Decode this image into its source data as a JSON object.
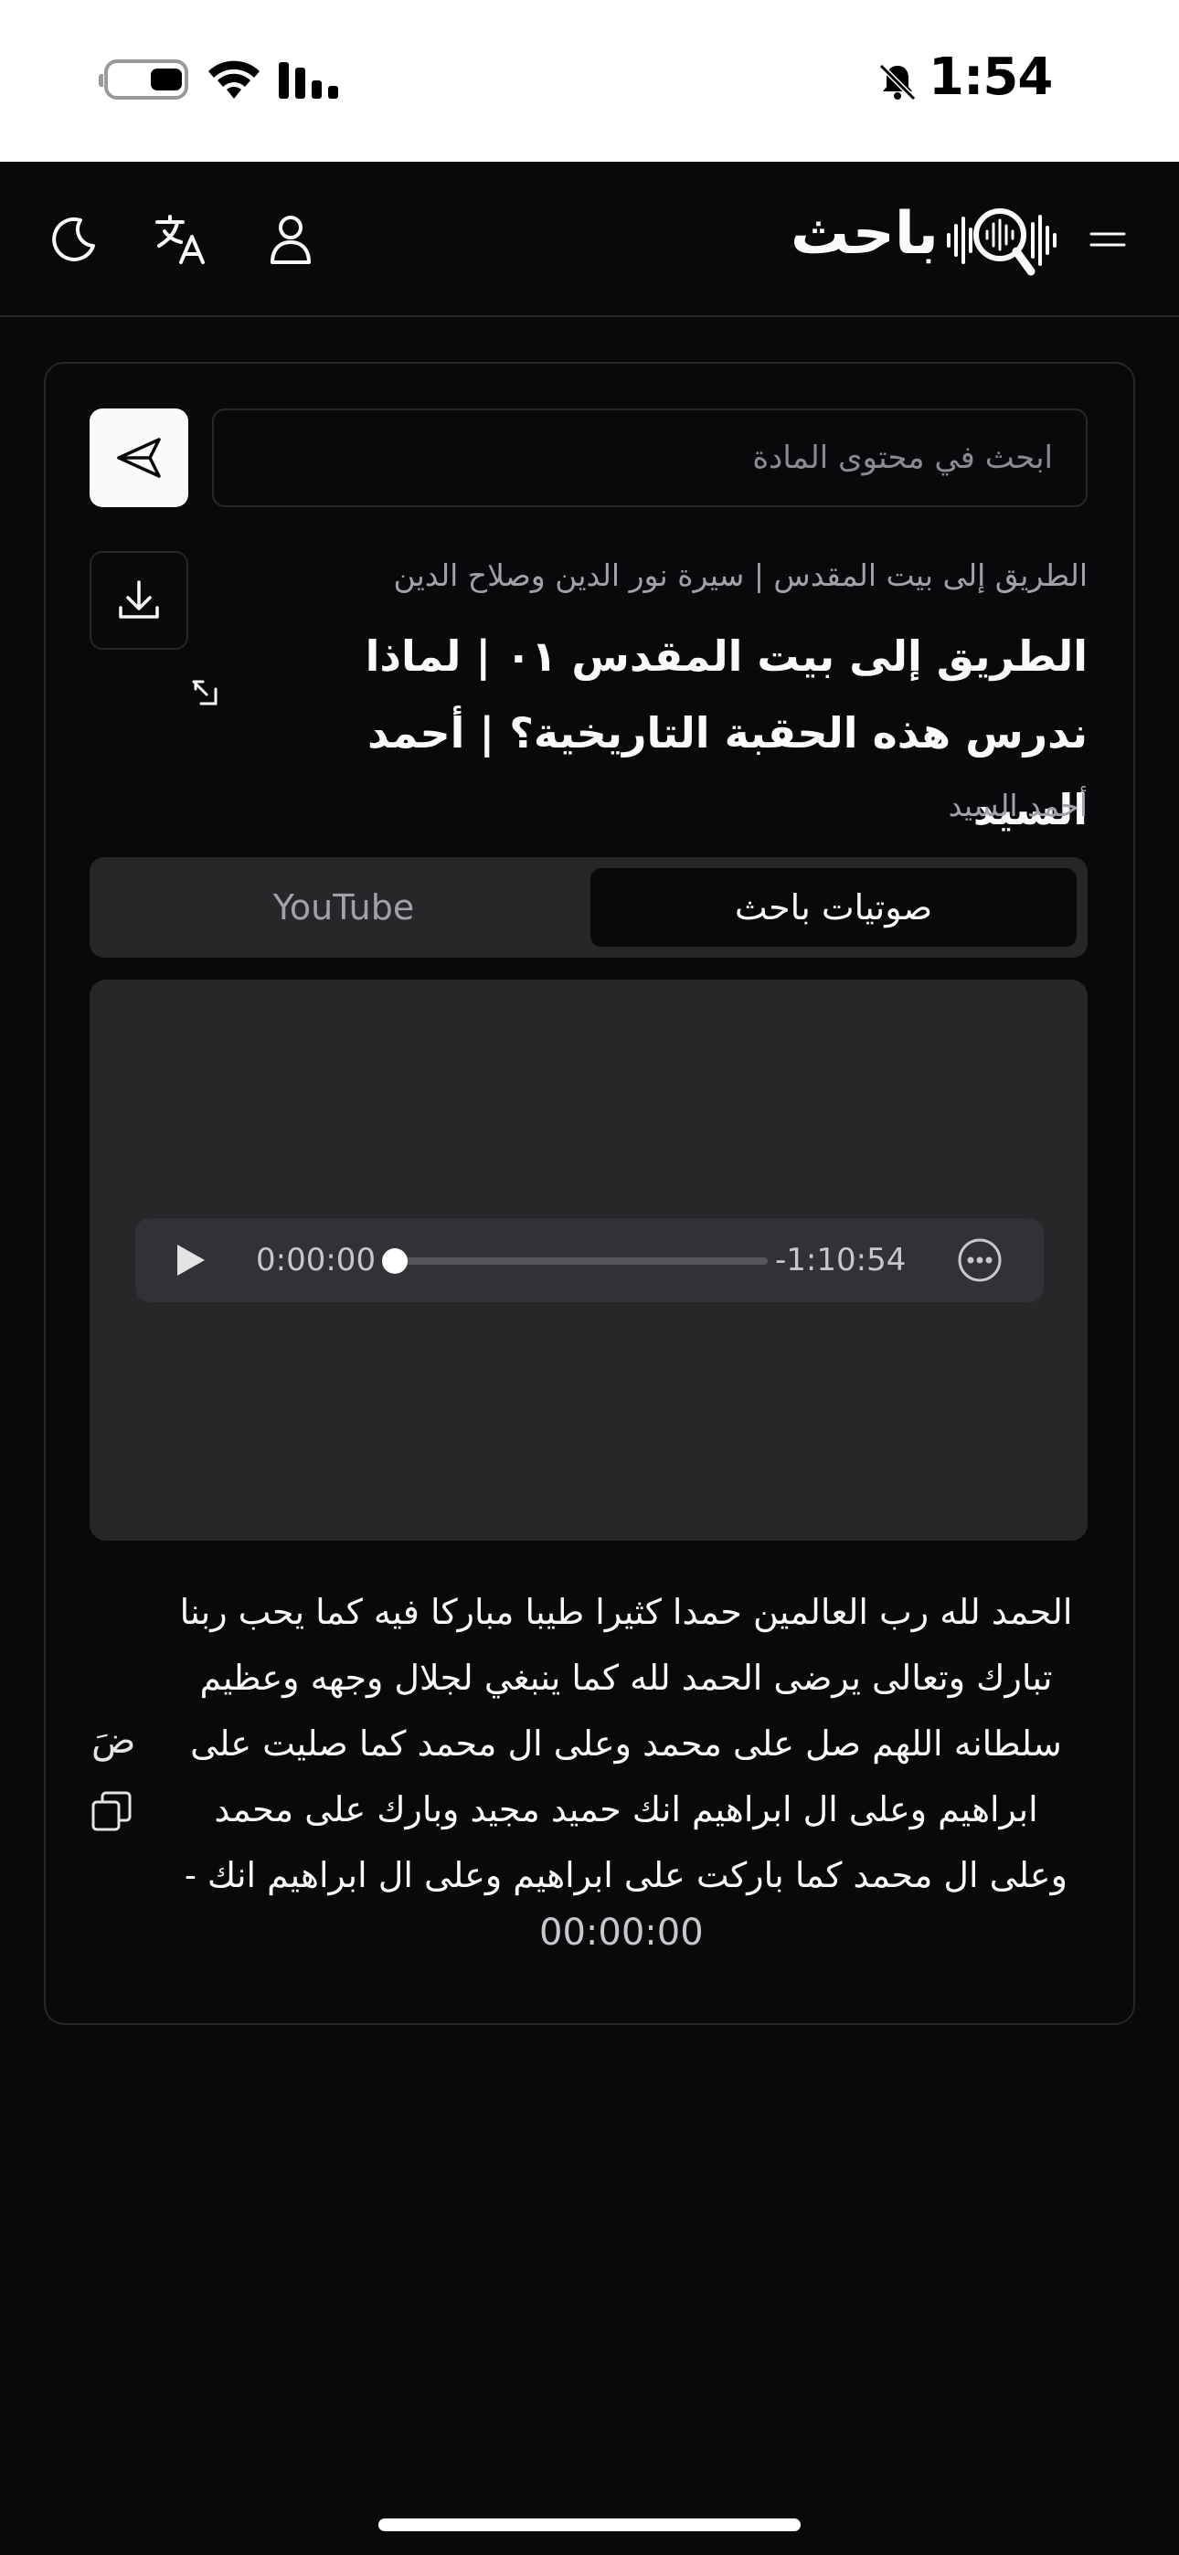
{
  "status_bar": {
    "time": "1:54"
  },
  "header": {
    "brand_name": "باحث"
  },
  "search": {
    "placeholder": "ابحث في محتوى المادة"
  },
  "content": {
    "breadcrumb": "الطريق إلى بيت المقدس | سيرة نور الدين وصلاح الدين",
    "title": "الطريق إلى بيت المقدس ٠١ | لماذا ندرس هذه الحقبة التاريخية؟ | أحمد السيد",
    "author": "أحمد السيد"
  },
  "tabs": {
    "youtube": "YouTube",
    "bahith_audio": "صوتيات باحث",
    "active": "bahith_audio"
  },
  "player": {
    "current_time": "0:00:00",
    "remaining_time": "-1:10:54",
    "progress": 0.02
  },
  "transcript": {
    "text": "الحمد لله رب العالمين حمدا كثيرا طيبا مباركا فيه كما يحب ربنا تبارك وتعالى يرضى الحمد لله كما ينبغي لجلال وجهه وعظيم سلطانه اللهم صل على محمد وعلى ال محمد كما صليت على ابراهيم وعلى ال ابراهيم انك حميد مجيد وبارك على محمد وعلى ال محمد كما باركت على ابراهيم وعلى ال ابراهيم انك -",
    "timestamp": "00:00:00",
    "side_letter": "ضَ"
  },
  "colors": {
    "background": "#09090b",
    "panel": "#27272a",
    "border": "#27272a",
    "muted_text": "#a1a1aa"
  }
}
